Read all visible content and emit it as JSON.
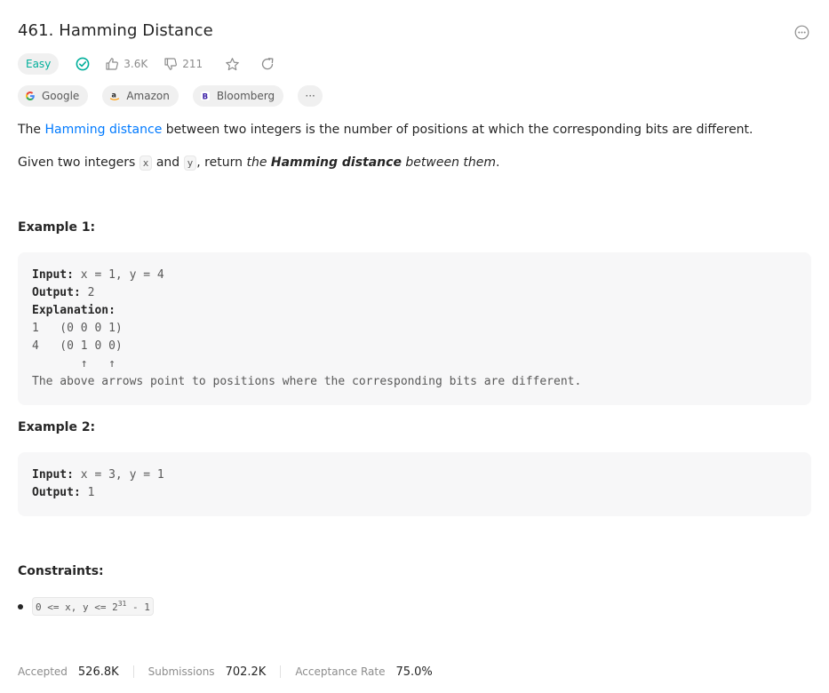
{
  "problem": {
    "title": "461. Hamming Distance",
    "difficulty": "Easy",
    "likes": "3.6K",
    "dislikes": "211"
  },
  "companies": [
    {
      "name": "Google"
    },
    {
      "name": "Amazon"
    },
    {
      "name": "Bloomberg"
    }
  ],
  "more_tags": "···",
  "description": {
    "p1_before": "The ",
    "p1_link": "Hamming distance",
    "p1_after": " between two integers is the number of positions at which the corresponding bits are different.",
    "p2_a": "Given two integers ",
    "p2_x": "x",
    "p2_b": " and ",
    "p2_y": "y",
    "p2_c": ", return ",
    "p2_the": "the",
    "p2_hd": "Hamming distance",
    "p2_between": "between them",
    "p2_end": "."
  },
  "example1": {
    "heading": "Example 1:",
    "input_label": "Input:",
    "input_value": " x = 1, y = 4",
    "output_label": "Output:",
    "output_value": " 2",
    "explanation_label": "Explanation:",
    "lines": [
      "1   (0 0 0 1)",
      "4   (0 1 0 0)",
      "       ↑   ↑",
      "The above arrows point to positions where the corresponding bits are different."
    ]
  },
  "example2": {
    "heading": "Example 2:",
    "input_label": "Input:",
    "input_value": " x = 3, y = 1",
    "output_label": "Output:",
    "output_value": " 1"
  },
  "constraints": {
    "heading": "Constraints:",
    "item_before": "0 <= x, y <= 2",
    "item_sup": "31",
    "item_after": " - 1"
  },
  "stats": {
    "accepted_label": "Accepted",
    "accepted_value": "526.8K",
    "submissions_label": "Submissions",
    "submissions_value": "702.2K",
    "rate_label": "Acceptance Rate",
    "rate_value": "75.0%"
  },
  "colors": {
    "easy": "#00af9b",
    "link": "#007aff"
  }
}
